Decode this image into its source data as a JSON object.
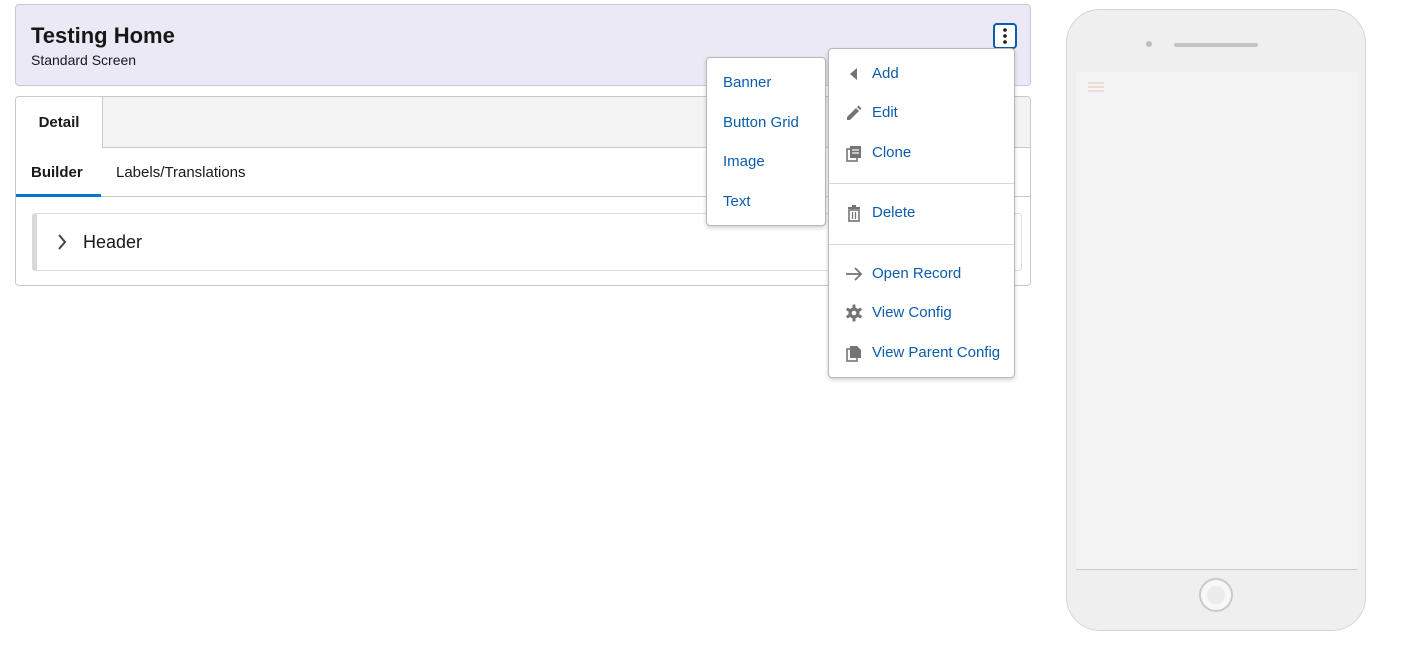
{
  "header": {
    "title": "Testing Home",
    "subtitle": "Standard Screen"
  },
  "tabs": [
    {
      "label": "Detail",
      "active": true
    }
  ],
  "subtabs": [
    {
      "label": "Builder",
      "active": true
    },
    {
      "label": "Labels/Translations",
      "active": false
    }
  ],
  "sections": [
    {
      "label": "Header",
      "expanded": false
    }
  ],
  "actions_menu": {
    "items": [
      {
        "label": "Add",
        "icon": "left-arrow-icon"
      },
      {
        "label": "Edit",
        "icon": "pencil-icon"
      },
      {
        "label": "Clone",
        "icon": "copy-icon"
      },
      {
        "label": "Delete",
        "icon": "trash-icon"
      },
      {
        "label": "Open Record",
        "icon": "arrow-right-icon"
      },
      {
        "label": "View Config",
        "icon": "gear-icon"
      },
      {
        "label": "View Parent Config",
        "icon": "document-icon"
      }
    ]
  },
  "add_submenu": {
    "items": [
      "Banner",
      "Button Grid",
      "Image",
      "Text"
    ]
  },
  "colors": {
    "header_bg": "#ebe9f6",
    "link": "#0b5cab",
    "accent": "#0176d3"
  }
}
